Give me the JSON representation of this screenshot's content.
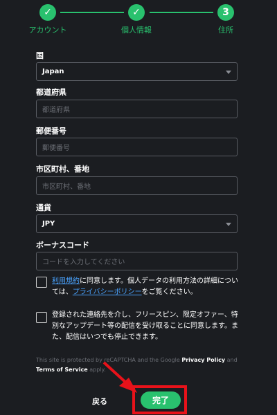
{
  "stepper": {
    "steps": [
      {
        "label": "アカウント",
        "marker": "✓"
      },
      {
        "label": "個人情報",
        "marker": "✓"
      },
      {
        "label": "住所",
        "marker": "3"
      }
    ]
  },
  "form": {
    "country": {
      "label": "国",
      "value": "Japan"
    },
    "prefecture": {
      "label": "都道府県",
      "placeholder": "都道府県"
    },
    "postal": {
      "label": "郵便番号",
      "placeholder": "郵便番号"
    },
    "city": {
      "label": "市区町村、番地",
      "placeholder": "市区町村、番地"
    },
    "currency": {
      "label": "通貨",
      "value": "JPY"
    },
    "bonus": {
      "label": "ボーナスコード",
      "placeholder": "コードを入力してください"
    }
  },
  "terms": {
    "link": "利用規約",
    "text1": "に同意します。個人データの利用方法の詳細については、",
    "privacy_link": "プライバシーポリシー",
    "text2": "をご覧ください。"
  },
  "marketing": {
    "text": "登録された連絡先を介し、フリースピン、限定オファー、特別なアップデート等の配信を受け取ることに同意します。また、配信はいつでも停止できます。"
  },
  "recaptcha": {
    "text1": "This site is protected by reCAPTCHA and the Google ",
    "privacy": "Privacy Policy",
    "and": " and ",
    "terms": "Terms of Service",
    "apply": " apply."
  },
  "actions": {
    "back": "戻る",
    "done": "完了"
  },
  "colors": {
    "accent": "#29c16e",
    "highlight": "#e8121a",
    "link": "#4aa3ff"
  }
}
